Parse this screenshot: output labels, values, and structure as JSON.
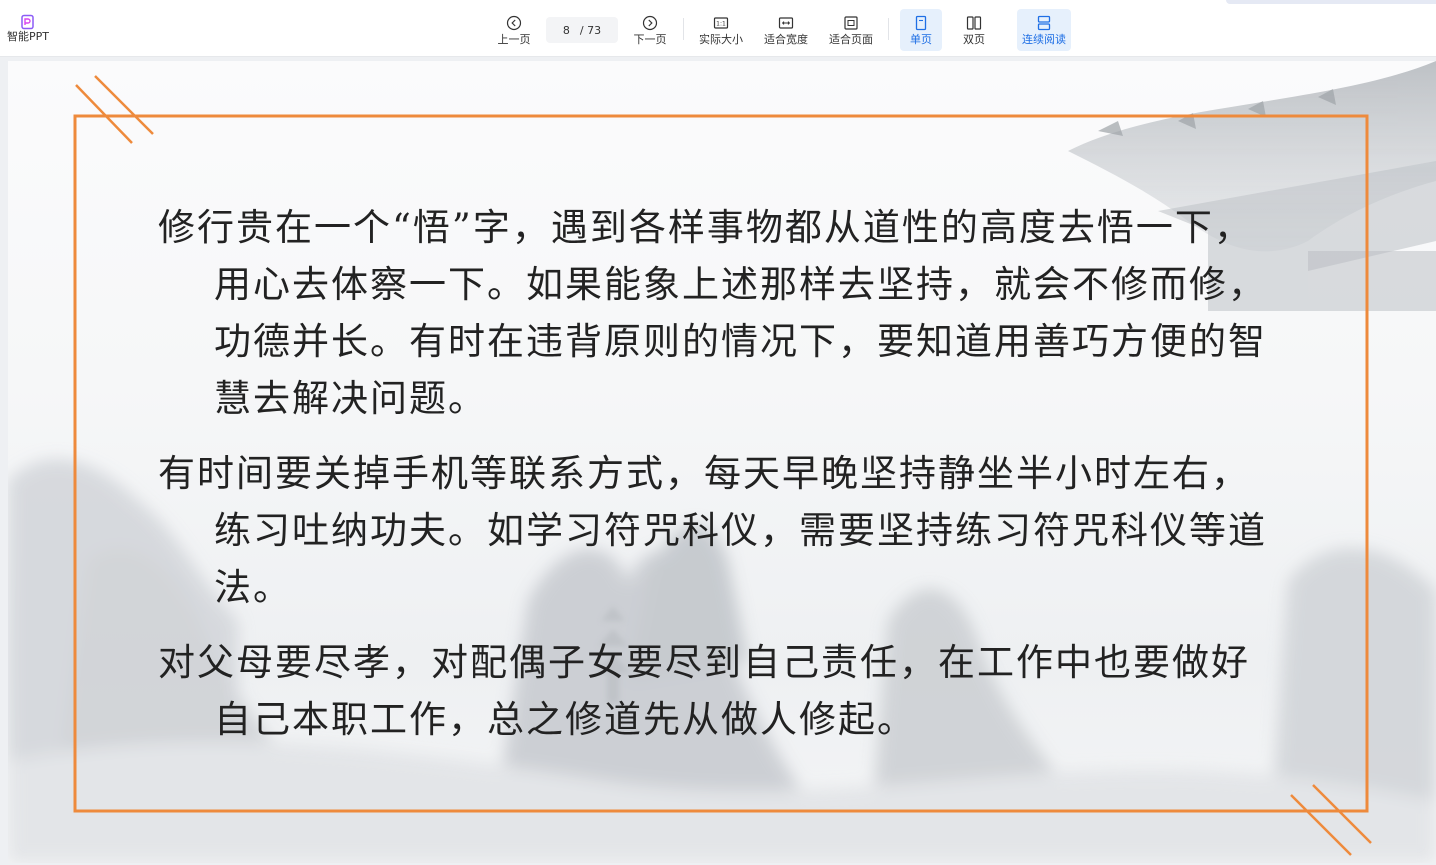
{
  "toolbar": {
    "smart_ppt_label": "智能PPT",
    "prev_label": "上一页",
    "current_page": "8",
    "total_pages": "/ 73",
    "next_label": "下一页",
    "actual_size_label": "实际大小",
    "fit_width_label": "适合宽度",
    "fit_page_label": "适合页面",
    "single_page_label": "单页",
    "double_page_label": "双页",
    "continuous_label": "连续阅读",
    "actual_size_glyph": "1:1"
  },
  "slide": {
    "paragraphs": [
      "修行贵在一个“悟”字，遇到各样事物都从道性的高度去悟一下， 用心去体察一下。如果能象上述那样去坚持，就会不修而修，功德并长。有时在违背原则的情况下，要知道用善巧方便的智慧去解决问题。",
      "有时间要关掉手机等联系方式，每天早晚坚持静坐半小时左右，练习吐纳功夫。如学习符咒科仪，需要坚持练习符咒科仪等道法。",
      "对父母要尽孝，对配偶子女要尽到自己责任，在工作中也要做好自己本职工作，总之修道先从做人修起。"
    ]
  },
  "colors": {
    "frame_orange": "#ee8a3c",
    "active_blue": "#1f6fe5",
    "active_bg": "#e6f0fc"
  }
}
